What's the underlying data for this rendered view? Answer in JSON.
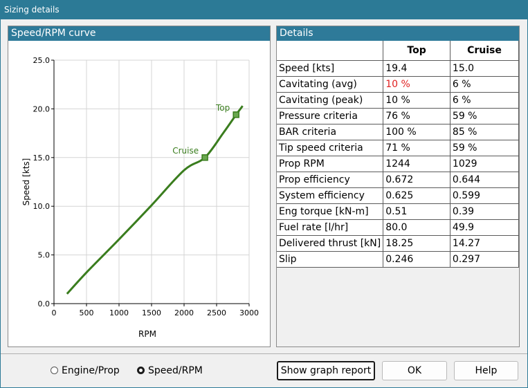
{
  "window": {
    "title": "Sizing details"
  },
  "chart_panel": {
    "header": "Speed/RPM curve"
  },
  "details_panel": {
    "header": "Details",
    "columns": [
      "",
      "Top",
      "Cruise"
    ],
    "rows": [
      {
        "label": "Speed [kts]",
        "top": "19.4",
        "cruise": "15.0"
      },
      {
        "label": "Cavitating (avg)",
        "top": "10 %",
        "cruise": "6 %"
      },
      {
        "label": "Cavitating (peak)",
        "top": "10 %",
        "cruise": "6 %"
      },
      {
        "label": "Pressure criteria",
        "top": "76 %",
        "cruise": "59 %"
      },
      {
        "label": "BAR criteria",
        "top": "100 %",
        "cruise": "85 %"
      },
      {
        "label": "Tip speed criteria",
        "top": "71 %",
        "cruise": "59 %"
      },
      {
        "label": "Prop RPM",
        "top": "1244",
        "cruise": "1029"
      },
      {
        "label": "Prop efficiency",
        "top": "0.672",
        "cruise": "0.644"
      },
      {
        "label": "System efficiency",
        "top": "0.625",
        "cruise": "0.599"
      },
      {
        "label": "Eng torque [kN-m]",
        "top": "0.51",
        "cruise": "0.39"
      },
      {
        "label": "Fuel rate [l/hr]",
        "top": "80.0",
        "cruise": "49.9"
      },
      {
        "label": "Delivered thrust [kN]",
        "top": "18.25",
        "cruise": "14.27"
      },
      {
        "label": "Slip",
        "top": "0.246",
        "cruise": "0.297"
      }
    ],
    "warning_color": "#e02020"
  },
  "bottom": {
    "radio_engine_prop": "Engine/Prop",
    "radio_speed_rpm": "Speed/RPM",
    "selected": "Speed/RPM",
    "show_graph_report": "Show graph report",
    "ok": "OK",
    "help": "Help"
  },
  "chart_data": {
    "type": "line",
    "xlabel": "RPM",
    "ylabel": "Speed [kts]",
    "xlim": [
      0,
      3000
    ],
    "ylim": [
      0,
      25
    ],
    "x_ticks": [
      "0",
      "500",
      "1000",
      "1500",
      "2000",
      "2500",
      "3000"
    ],
    "y_ticks": [
      "0.0",
      "5.0",
      "10.0",
      "15.0",
      "20.0",
      "25.0"
    ],
    "grid": true,
    "line_color": "#3a7d1e",
    "series": [
      {
        "x": [
          200,
          500,
          1000,
          1500,
          2000,
          2320,
          2600,
          2800,
          2900
        ],
        "y": [
          1.0,
          3.2,
          6.6,
          10.1,
          13.7,
          15.0,
          17.5,
          19.4,
          20.3
        ]
      }
    ],
    "points": [
      {
        "label": "Cruise",
        "x": 2320,
        "y": 15.0
      },
      {
        "label": "Top",
        "x": 2800,
        "y": 19.4
      }
    ]
  }
}
